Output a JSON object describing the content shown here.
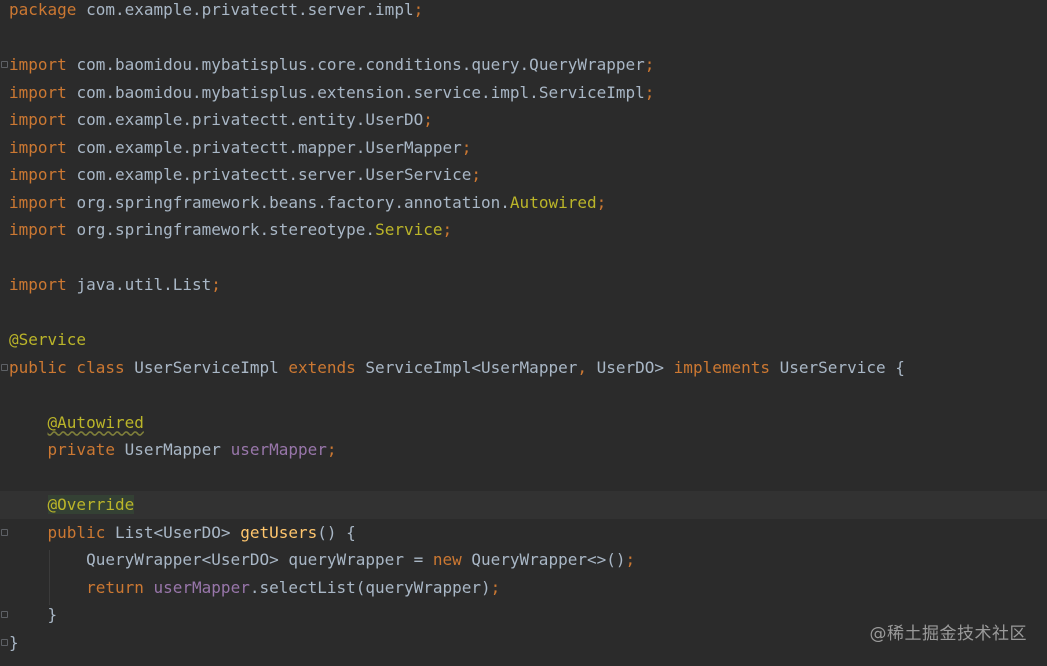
{
  "lines": [
    {
      "segments": [
        {
          "t": "package ",
          "c": "kw"
        },
        {
          "t": "com.example.privatectt.server.impl",
          "c": "plain"
        },
        {
          "t": ";",
          "c": "semi"
        }
      ]
    },
    {
      "segments": []
    },
    {
      "segments": [
        {
          "t": "import ",
          "c": "kw"
        },
        {
          "t": "com.baomidou.mybatisplus.core.conditions.query.QueryWrapper",
          "c": "plain"
        },
        {
          "t": ";",
          "c": "semi"
        }
      ]
    },
    {
      "segments": [
        {
          "t": "import ",
          "c": "kw"
        },
        {
          "t": "com.baomidou.mybatisplus.extension.service.impl.ServiceImpl",
          "c": "plain"
        },
        {
          "t": ";",
          "c": "semi"
        }
      ]
    },
    {
      "segments": [
        {
          "t": "import ",
          "c": "kw"
        },
        {
          "t": "com.example.privatectt.entity.UserDO",
          "c": "plain"
        },
        {
          "t": ";",
          "c": "semi"
        }
      ]
    },
    {
      "segments": [
        {
          "t": "import ",
          "c": "kw"
        },
        {
          "t": "com.example.privatectt.mapper.UserMapper",
          "c": "plain"
        },
        {
          "t": ";",
          "c": "semi"
        }
      ]
    },
    {
      "segments": [
        {
          "t": "import ",
          "c": "kw"
        },
        {
          "t": "com.example.privatectt.server.UserService",
          "c": "plain"
        },
        {
          "t": ";",
          "c": "semi"
        }
      ]
    },
    {
      "segments": [
        {
          "t": "import ",
          "c": "kw"
        },
        {
          "t": "org.springframework.beans.factory.annotation.",
          "c": "plain"
        },
        {
          "t": "Autowired",
          "c": "ann"
        },
        {
          "t": ";",
          "c": "semi"
        }
      ]
    },
    {
      "segments": [
        {
          "t": "import ",
          "c": "kw"
        },
        {
          "t": "org.springframework.stereotype.",
          "c": "plain"
        },
        {
          "t": "Service",
          "c": "ann"
        },
        {
          "t": ";",
          "c": "semi"
        }
      ]
    },
    {
      "segments": []
    },
    {
      "segments": [
        {
          "t": "import ",
          "c": "kw"
        },
        {
          "t": "java.util.List",
          "c": "plain"
        },
        {
          "t": ";",
          "c": "semi"
        }
      ]
    },
    {
      "segments": []
    },
    {
      "segments": [
        {
          "t": "@Service",
          "c": "ann"
        }
      ]
    },
    {
      "segments": [
        {
          "t": "public class ",
          "c": "kw"
        },
        {
          "t": "UserServiceImpl ",
          "c": "plain"
        },
        {
          "t": "extends ",
          "c": "kw"
        },
        {
          "t": "ServiceImpl<UserMapper",
          "c": "plain"
        },
        {
          "t": ", ",
          "c": "semi"
        },
        {
          "t": "UserDO> ",
          "c": "plain"
        },
        {
          "t": "implements ",
          "c": "kw"
        },
        {
          "t": "UserService {",
          "c": "plain"
        }
      ]
    },
    {
      "segments": []
    },
    {
      "segments": [
        {
          "t": "    ",
          "c": "plain"
        },
        {
          "t": "@Autowired",
          "c": "ann squiggle"
        }
      ]
    },
    {
      "segments": [
        {
          "t": "    ",
          "c": "plain"
        },
        {
          "t": "private ",
          "c": "kw"
        },
        {
          "t": "UserMapper ",
          "c": "plain"
        },
        {
          "t": "userMapper",
          "c": "fld"
        },
        {
          "t": ";",
          "c": "semi"
        }
      ]
    },
    {
      "segments": []
    },
    {
      "segments": [
        {
          "t": "    ",
          "c": "plain"
        },
        {
          "t": "@Override",
          "c": "ann override-bg"
        }
      ],
      "current": true
    },
    {
      "segments": [
        {
          "t": "    ",
          "c": "plain"
        },
        {
          "t": "public ",
          "c": "kw"
        },
        {
          "t": "List<UserDO> ",
          "c": "plain"
        },
        {
          "t": "getUsers",
          "c": "fn"
        },
        {
          "t": "() {",
          "c": "plain"
        }
      ]
    },
    {
      "segments": [
        {
          "t": "        ",
          "c": "plain"
        },
        {
          "t": "QueryWrapper<UserDO> queryWrapper = ",
          "c": "plain"
        },
        {
          "t": "new ",
          "c": "kw"
        },
        {
          "t": "QueryWrapper<>()",
          "c": "plain"
        },
        {
          "t": ";",
          "c": "semi"
        }
      ]
    },
    {
      "segments": [
        {
          "t": "        ",
          "c": "plain"
        },
        {
          "t": "return ",
          "c": "kw"
        },
        {
          "t": "userMapper",
          "c": "fld"
        },
        {
          "t": ".selectList(queryWrapper)",
          "c": "plain"
        },
        {
          "t": ";",
          "c": "semi"
        }
      ]
    },
    {
      "segments": [
        {
          "t": "    }",
          "c": "plain"
        }
      ]
    },
    {
      "segments": [
        {
          "t": "}",
          "c": "plain"
        }
      ]
    }
  ],
  "watermark": "@稀土掘金技术社区"
}
